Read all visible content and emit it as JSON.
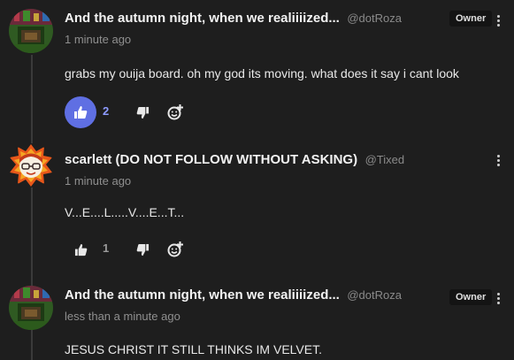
{
  "comments": [
    {
      "author": "And the autumn night, when we realiiiized...",
      "handle": "@dotRoza",
      "time": "1 minute ago",
      "badge": "Owner",
      "text": "grabs my ouija board. oh my god its moving. what does it say i cant look",
      "likes": "2",
      "liked": true
    },
    {
      "author": "scarlett (DO NOT FOLLOW WITHOUT ASKING)",
      "handle": "@Tixed",
      "time": "1 minute ago",
      "text": "V...E....L.....V....E...T...",
      "likes": "1",
      "liked": false
    },
    {
      "author": "And the autumn night, when we realiiiized...",
      "handle": "@dotRoza",
      "time": "less than a minute ago",
      "badge": "Owner",
      "text": "JESUS CHRIST IT STILL THINKS IM VELVET."
    }
  ],
  "colors": {
    "background": "#1e1e1e",
    "like_active": "#5f6fe3",
    "like_count_active": "#8e9cff",
    "muted_text": "#8f8f8f"
  },
  "icons": {
    "like": "thumbs-up-icon",
    "dislike": "thumbs-down-icon",
    "react": "add-emoji-icon",
    "menu": "kebab-menu-icon"
  }
}
